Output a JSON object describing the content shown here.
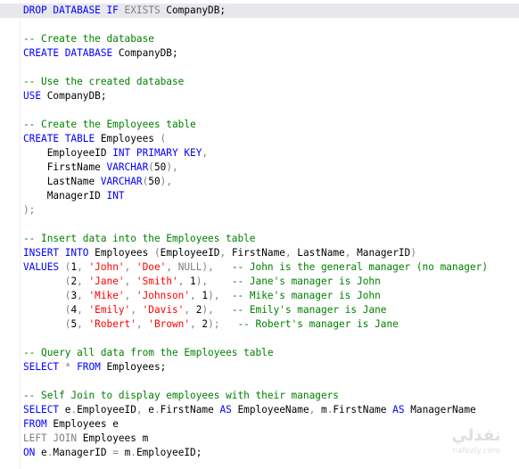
{
  "editor": {
    "lines": [
      [
        {
          "t": "DROP DATABASE IF ",
          "c": "kw"
        },
        {
          "t": "EXISTS",
          "c": "kw-gray"
        },
        {
          "t": " CompanyDB;",
          "c": ""
        }
      ],
      [],
      [
        {
          "t": "-- Create the database",
          "c": "cm"
        }
      ],
      [
        {
          "t": "CREATE DATABASE",
          "c": "kw"
        },
        {
          "t": " CompanyDB;",
          "c": ""
        }
      ],
      [],
      [
        {
          "t": "-- Use the created database",
          "c": "cm"
        }
      ],
      [
        {
          "t": "USE",
          "c": "kw"
        },
        {
          "t": " CompanyDB;",
          "c": ""
        }
      ],
      [],
      [
        {
          "t": "-- Create the Employees table",
          "c": "cm"
        }
      ],
      [
        {
          "t": "CREATE TABLE",
          "c": "kw"
        },
        {
          "t": " Employees ",
          "c": ""
        },
        {
          "t": "(",
          "c": "op"
        }
      ],
      [
        {
          "t": "    EmployeeID ",
          "c": ""
        },
        {
          "t": "INT PRIMARY KEY",
          "c": "kw"
        },
        {
          "t": ",",
          "c": "op"
        }
      ],
      [
        {
          "t": "    FirstName ",
          "c": ""
        },
        {
          "t": "VARCHAR",
          "c": "kw"
        },
        {
          "t": "(",
          "c": "op"
        },
        {
          "t": "50",
          "c": ""
        },
        {
          "t": "),",
          "c": "op"
        }
      ],
      [
        {
          "t": "    LastName ",
          "c": ""
        },
        {
          "t": "VARCHAR",
          "c": "kw"
        },
        {
          "t": "(",
          "c": "op"
        },
        {
          "t": "50",
          "c": ""
        },
        {
          "t": "),",
          "c": "op"
        }
      ],
      [
        {
          "t": "    ManagerID ",
          "c": ""
        },
        {
          "t": "INT",
          "c": "kw"
        }
      ],
      [
        {
          "t": ");",
          "c": "op"
        }
      ],
      [],
      [
        {
          "t": "-- Insert data into the Employees table",
          "c": "cm"
        }
      ],
      [
        {
          "t": "INSERT INTO",
          "c": "kw"
        },
        {
          "t": " Employees ",
          "c": ""
        },
        {
          "t": "(",
          "c": "op"
        },
        {
          "t": "EmployeeID",
          "c": ""
        },
        {
          "t": ",",
          "c": "op"
        },
        {
          "t": " FirstName",
          "c": ""
        },
        {
          "t": ",",
          "c": "op"
        },
        {
          "t": " LastName",
          "c": ""
        },
        {
          "t": ",",
          "c": "op"
        },
        {
          "t": " ManagerID",
          "c": ""
        },
        {
          "t": ")",
          "c": "op"
        }
      ],
      [
        {
          "t": "VALUES",
          "c": "kw"
        },
        {
          "t": " (",
          "c": "op"
        },
        {
          "t": "1",
          "c": ""
        },
        {
          "t": ", ",
          "c": "op"
        },
        {
          "t": "'John'",
          "c": "st"
        },
        {
          "t": ", ",
          "c": "op"
        },
        {
          "t": "'Doe'",
          "c": "st"
        },
        {
          "t": ", ",
          "c": "op"
        },
        {
          "t": "NULL",
          "c": "kw-gray"
        },
        {
          "t": "),",
          "c": "op"
        },
        {
          "t": "   ",
          "c": ""
        },
        {
          "t": "-- John is the general manager (no manager)",
          "c": "cm"
        }
      ],
      [
        {
          "t": "       (",
          "c": "op"
        },
        {
          "t": "2",
          "c": ""
        },
        {
          "t": ", ",
          "c": "op"
        },
        {
          "t": "'Jane'",
          "c": "st"
        },
        {
          "t": ", ",
          "c": "op"
        },
        {
          "t": "'Smith'",
          "c": "st"
        },
        {
          "t": ", ",
          "c": "op"
        },
        {
          "t": "1",
          "c": ""
        },
        {
          "t": "),",
          "c": "op"
        },
        {
          "t": "    ",
          "c": ""
        },
        {
          "t": "-- Jane's manager is John",
          "c": "cm"
        }
      ],
      [
        {
          "t": "       (",
          "c": "op"
        },
        {
          "t": "3",
          "c": ""
        },
        {
          "t": ", ",
          "c": "op"
        },
        {
          "t": "'Mike'",
          "c": "st"
        },
        {
          "t": ", ",
          "c": "op"
        },
        {
          "t": "'Johnson'",
          "c": "st"
        },
        {
          "t": ", ",
          "c": "op"
        },
        {
          "t": "1",
          "c": ""
        },
        {
          "t": "),",
          "c": "op"
        },
        {
          "t": "  ",
          "c": ""
        },
        {
          "t": "-- Mike's manager is John",
          "c": "cm"
        }
      ],
      [
        {
          "t": "       (",
          "c": "op"
        },
        {
          "t": "4",
          "c": ""
        },
        {
          "t": ", ",
          "c": "op"
        },
        {
          "t": "'Emily'",
          "c": "st"
        },
        {
          "t": ", ",
          "c": "op"
        },
        {
          "t": "'Davis'",
          "c": "st"
        },
        {
          "t": ", ",
          "c": "op"
        },
        {
          "t": "2",
          "c": ""
        },
        {
          "t": "),",
          "c": "op"
        },
        {
          "t": "   ",
          "c": ""
        },
        {
          "t": "-- Emily's manager is Jane",
          "c": "cm"
        }
      ],
      [
        {
          "t": "       (",
          "c": "op"
        },
        {
          "t": "5",
          "c": ""
        },
        {
          "t": ", ",
          "c": "op"
        },
        {
          "t": "'Robert'",
          "c": "st"
        },
        {
          "t": ", ",
          "c": "op"
        },
        {
          "t": "'Brown'",
          "c": "st"
        },
        {
          "t": ", ",
          "c": "op"
        },
        {
          "t": "2",
          "c": ""
        },
        {
          "t": ");",
          "c": "op"
        },
        {
          "t": "   ",
          "c": ""
        },
        {
          "t": "-- Robert's manager is Jane",
          "c": "cm"
        }
      ],
      [],
      [
        {
          "t": "-- Query all data from the Employees table",
          "c": "cm"
        }
      ],
      [
        {
          "t": "SELECT",
          "c": "kw"
        },
        {
          "t": " * ",
          "c": "op"
        },
        {
          "t": "FROM",
          "c": "kw"
        },
        {
          "t": " Employees;",
          "c": ""
        }
      ],
      [],
      [
        {
          "t": "-- Self Join to display employees with their managers",
          "c": "cm"
        }
      ],
      [
        {
          "t": "SELECT",
          "c": "kw"
        },
        {
          "t": " e",
          "c": ""
        },
        {
          "t": ".",
          "c": "op"
        },
        {
          "t": "EmployeeID",
          "c": ""
        },
        {
          "t": ",",
          "c": "op"
        },
        {
          "t": " e",
          "c": ""
        },
        {
          "t": ".",
          "c": "op"
        },
        {
          "t": "FirstName ",
          "c": ""
        },
        {
          "t": "AS",
          "c": "kw"
        },
        {
          "t": " EmployeeName",
          "c": ""
        },
        {
          "t": ",",
          "c": "op"
        },
        {
          "t": " m",
          "c": ""
        },
        {
          "t": ".",
          "c": "op"
        },
        {
          "t": "FirstName ",
          "c": ""
        },
        {
          "t": "AS",
          "c": "kw"
        },
        {
          "t": " ManagerName",
          "c": ""
        }
      ],
      [
        {
          "t": "FROM",
          "c": "kw"
        },
        {
          "t": " Employees e",
          "c": ""
        }
      ],
      [
        {
          "t": "LEFT JOIN",
          "c": "kw-gray"
        },
        {
          "t": " Employees m",
          "c": ""
        }
      ],
      [
        {
          "t": "ON",
          "c": "kw"
        },
        {
          "t": " e",
          "c": ""
        },
        {
          "t": ".",
          "c": "op"
        },
        {
          "t": "ManagerID ",
          "c": ""
        },
        {
          "t": "=",
          "c": "op"
        },
        {
          "t": " m",
          "c": ""
        },
        {
          "t": ".",
          "c": "op"
        },
        {
          "t": "EmployeeID;",
          "c": ""
        }
      ]
    ]
  },
  "watermark": {
    "arabic": "نفذلي",
    "latin": "nafezly.com"
  }
}
